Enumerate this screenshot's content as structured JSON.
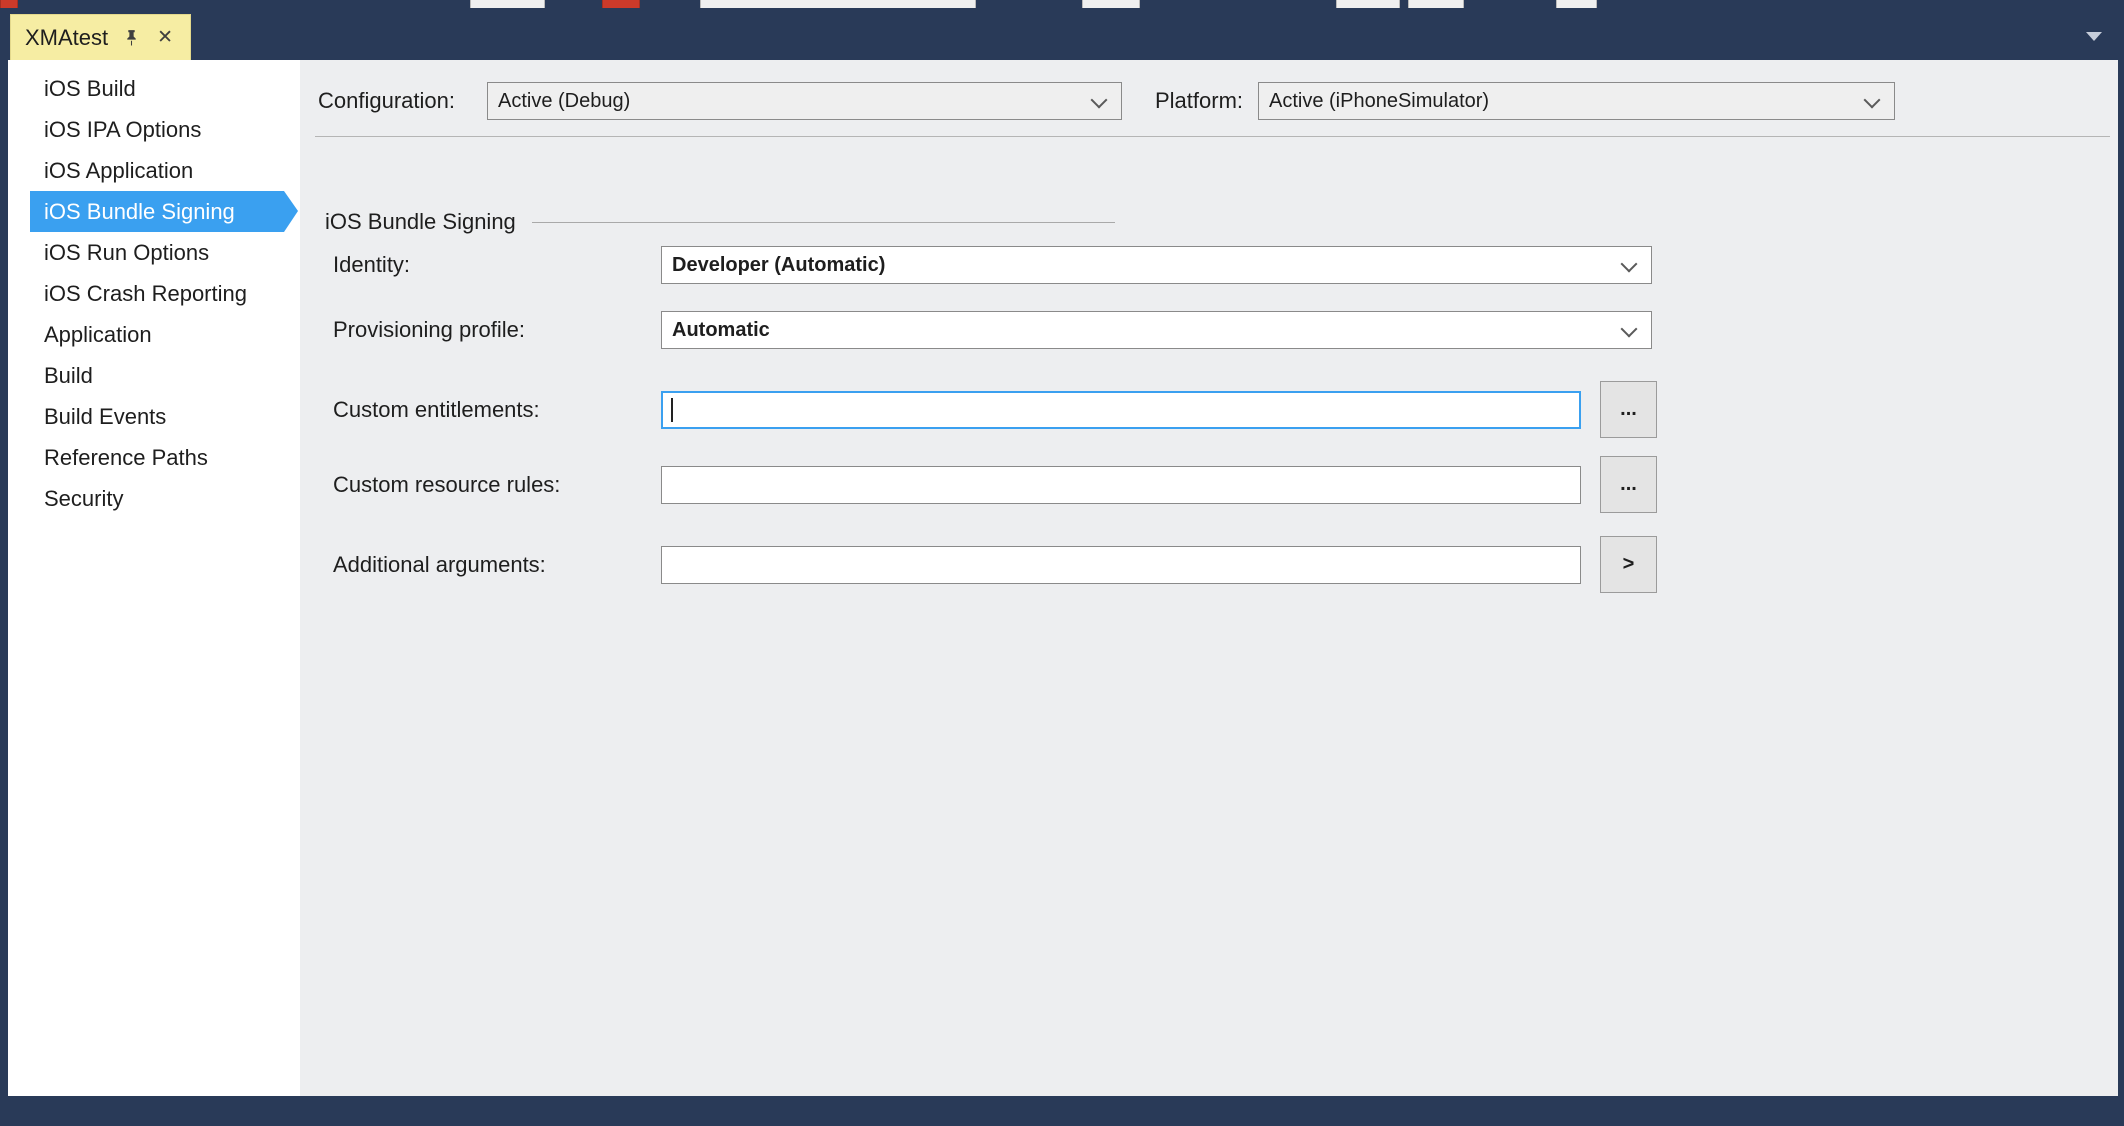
{
  "colors": {
    "frame_navy": "#293A58",
    "selection_blue": "#3AA0F0",
    "tab_yellow": "#F6EDA3",
    "panel_gray": "#EDEEF0",
    "focus_border_blue": "#3AA0F0"
  },
  "tab": {
    "title": "XMAtest",
    "pin_icon": "pushpin",
    "close_icon": "✕"
  },
  "sidebar": {
    "items": [
      {
        "label": "iOS Build",
        "selected": false
      },
      {
        "label": "iOS IPA Options",
        "selected": false
      },
      {
        "label": "iOS Application",
        "selected": false
      },
      {
        "label": "iOS Bundle Signing",
        "selected": true
      },
      {
        "label": "iOS Run Options",
        "selected": false
      },
      {
        "label": "iOS Crash Reporting",
        "selected": false
      },
      {
        "label": "Application",
        "selected": false
      },
      {
        "label": "Build",
        "selected": false
      },
      {
        "label": "Build Events",
        "selected": false
      },
      {
        "label": "Reference Paths",
        "selected": false
      },
      {
        "label": "Security",
        "selected": false
      }
    ]
  },
  "config_bar": {
    "configuration_label": "Configuration:",
    "configuration_value": "Active (Debug)",
    "platform_label": "Platform:",
    "platform_value": "Active (iPhoneSimulator)"
  },
  "section": {
    "title": "iOS Bundle Signing"
  },
  "form": {
    "identity": {
      "label": "Identity:",
      "value": "Developer (Automatic)"
    },
    "provisioning_profile": {
      "label": "Provisioning profile:",
      "value": "Automatic"
    },
    "custom_entitlements": {
      "label": "Custom entitlements:",
      "value": "",
      "browse_label": "..."
    },
    "custom_resource_rules": {
      "label": "Custom resource rules:",
      "value": "",
      "browse_label": "..."
    },
    "additional_arguments": {
      "label": "Additional arguments:",
      "value": "",
      "expand_label": ">"
    }
  }
}
